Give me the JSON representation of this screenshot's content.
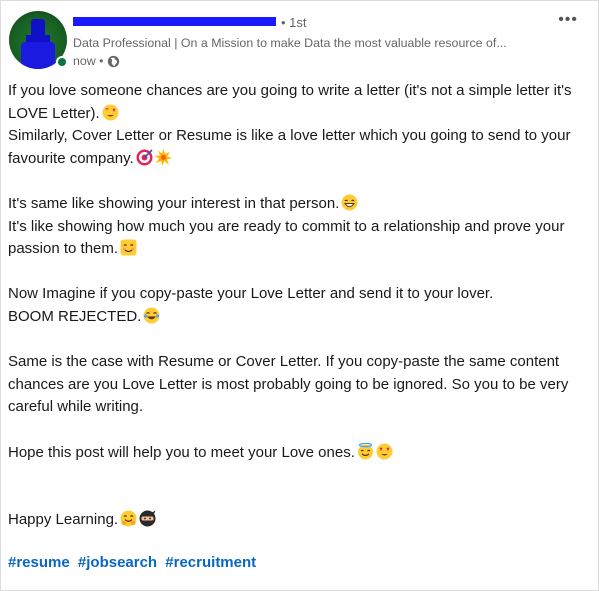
{
  "post": {
    "author": {
      "degree": "• 1st",
      "headline": "Data Professional | On a Mission to make Data the most valuable resource of...",
      "timestamp": "now •"
    },
    "paragraphs": [
      [
        "If you love someone chances are you going to write a letter (it's not a simple letter it's LOVE Letter).",
        "Similarly, Cover Letter or Resume is like a love letter which you going to send to your favourite company."
      ],
      [
        "It's same like showing your interest in that person.",
        "It's like showing how much you are ready to commit to a relationship and prove your passion to them."
      ],
      [
        "Now Imagine if you copy-paste your Love Letter and send it to your lover.",
        "BOOM REJECTED."
      ],
      [
        "Same is the case with Resume or Cover Letter. If you copy-paste the same content chances are you Love Letter is most probably going to be ignored. So you to be very careful while writing."
      ],
      [
        "Hope this post will help you to meet your Love ones."
      ],
      [
        "Happy Learning."
      ]
    ],
    "hashtags": [
      "#resume",
      "#jobsearch",
      "#recruitment"
    ],
    "colors": {
      "hashtag": "#0a66c2",
      "redaction": "#1a1aff",
      "online": "#057642",
      "emoji_face": "#ffcc33"
    }
  }
}
